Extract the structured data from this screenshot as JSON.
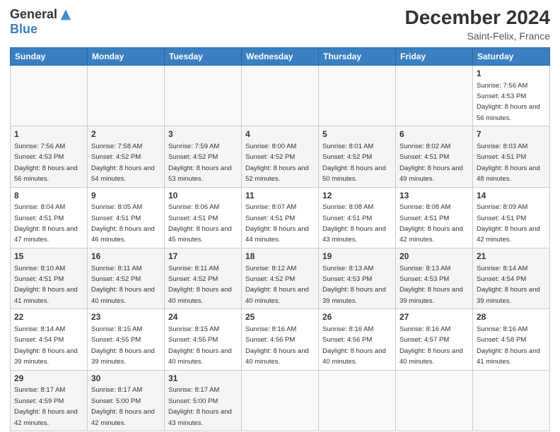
{
  "logo": {
    "general": "General",
    "blue": "Blue"
  },
  "header": {
    "title": "December 2024",
    "subtitle": "Saint-Felix, France"
  },
  "calendar": {
    "columns": [
      "Sunday",
      "Monday",
      "Tuesday",
      "Wednesday",
      "Thursday",
      "Friday",
      "Saturday"
    ],
    "weeks": [
      [
        null,
        null,
        null,
        null,
        null,
        null,
        {
          "day": "1",
          "sunrise": "Sunrise: 7:56 AM",
          "sunset": "Sunset: 4:53 PM",
          "daylight": "Daylight: 8 hours and 56 minutes."
        }
      ],
      [
        {
          "day": "1",
          "sunrise": "Sunrise: 7:56 AM",
          "sunset": "Sunset: 4:53 PM",
          "daylight": "Daylight: 8 hours and 56 minutes."
        },
        {
          "day": "2",
          "sunrise": "Sunrise: 7:58 AM",
          "sunset": "Sunset: 4:52 PM",
          "daylight": "Daylight: 8 hours and 54 minutes."
        },
        {
          "day": "3",
          "sunrise": "Sunrise: 7:59 AM",
          "sunset": "Sunset: 4:52 PM",
          "daylight": "Daylight: 8 hours and 53 minutes."
        },
        {
          "day": "4",
          "sunrise": "Sunrise: 8:00 AM",
          "sunset": "Sunset: 4:52 PM",
          "daylight": "Daylight: 8 hours and 52 minutes."
        },
        {
          "day": "5",
          "sunrise": "Sunrise: 8:01 AM",
          "sunset": "Sunset: 4:52 PM",
          "daylight": "Daylight: 8 hours and 50 minutes."
        },
        {
          "day": "6",
          "sunrise": "Sunrise: 8:02 AM",
          "sunset": "Sunset: 4:51 PM",
          "daylight": "Daylight: 8 hours and 49 minutes."
        },
        {
          "day": "7",
          "sunrise": "Sunrise: 8:03 AM",
          "sunset": "Sunset: 4:51 PM",
          "daylight": "Daylight: 8 hours and 48 minutes."
        }
      ],
      [
        {
          "day": "8",
          "sunrise": "Sunrise: 8:04 AM",
          "sunset": "Sunset: 4:51 PM",
          "daylight": "Daylight: 8 hours and 47 minutes."
        },
        {
          "day": "9",
          "sunrise": "Sunrise: 8:05 AM",
          "sunset": "Sunset: 4:51 PM",
          "daylight": "Daylight: 8 hours and 46 minutes."
        },
        {
          "day": "10",
          "sunrise": "Sunrise: 8:06 AM",
          "sunset": "Sunset: 4:51 PM",
          "daylight": "Daylight: 8 hours and 45 minutes."
        },
        {
          "day": "11",
          "sunrise": "Sunrise: 8:07 AM",
          "sunset": "Sunset: 4:51 PM",
          "daylight": "Daylight: 8 hours and 44 minutes."
        },
        {
          "day": "12",
          "sunrise": "Sunrise: 8:08 AM",
          "sunset": "Sunset: 4:51 PM",
          "daylight": "Daylight: 8 hours and 43 minutes."
        },
        {
          "day": "13",
          "sunrise": "Sunrise: 8:08 AM",
          "sunset": "Sunset: 4:51 PM",
          "daylight": "Daylight: 8 hours and 42 minutes."
        },
        {
          "day": "14",
          "sunrise": "Sunrise: 8:09 AM",
          "sunset": "Sunset: 4:51 PM",
          "daylight": "Daylight: 8 hours and 42 minutes."
        }
      ],
      [
        {
          "day": "15",
          "sunrise": "Sunrise: 8:10 AM",
          "sunset": "Sunset: 4:51 PM",
          "daylight": "Daylight: 8 hours and 41 minutes."
        },
        {
          "day": "16",
          "sunrise": "Sunrise: 8:11 AM",
          "sunset": "Sunset: 4:52 PM",
          "daylight": "Daylight: 8 hours and 40 minutes."
        },
        {
          "day": "17",
          "sunrise": "Sunrise: 8:11 AM",
          "sunset": "Sunset: 4:52 PM",
          "daylight": "Daylight: 8 hours and 40 minutes."
        },
        {
          "day": "18",
          "sunrise": "Sunrise: 8:12 AM",
          "sunset": "Sunset: 4:52 PM",
          "daylight": "Daylight: 8 hours and 40 minutes."
        },
        {
          "day": "19",
          "sunrise": "Sunrise: 8:13 AM",
          "sunset": "Sunset: 4:53 PM",
          "daylight": "Daylight: 8 hours and 39 minutes."
        },
        {
          "day": "20",
          "sunrise": "Sunrise: 8:13 AM",
          "sunset": "Sunset: 4:53 PM",
          "daylight": "Daylight: 8 hours and 39 minutes."
        },
        {
          "day": "21",
          "sunrise": "Sunrise: 8:14 AM",
          "sunset": "Sunset: 4:54 PM",
          "daylight": "Daylight: 8 hours and 39 minutes."
        }
      ],
      [
        {
          "day": "22",
          "sunrise": "Sunrise: 8:14 AM",
          "sunset": "Sunset: 4:54 PM",
          "daylight": "Daylight: 8 hours and 39 minutes."
        },
        {
          "day": "23",
          "sunrise": "Sunrise: 8:15 AM",
          "sunset": "Sunset: 4:55 PM",
          "daylight": "Daylight: 8 hours and 39 minutes."
        },
        {
          "day": "24",
          "sunrise": "Sunrise: 8:15 AM",
          "sunset": "Sunset: 4:55 PM",
          "daylight": "Daylight: 8 hours and 40 minutes."
        },
        {
          "day": "25",
          "sunrise": "Sunrise: 8:16 AM",
          "sunset": "Sunset: 4:56 PM",
          "daylight": "Daylight: 8 hours and 40 minutes."
        },
        {
          "day": "26",
          "sunrise": "Sunrise: 8:16 AM",
          "sunset": "Sunset: 4:56 PM",
          "daylight": "Daylight: 8 hours and 40 minutes."
        },
        {
          "day": "27",
          "sunrise": "Sunrise: 8:16 AM",
          "sunset": "Sunset: 4:57 PM",
          "daylight": "Daylight: 8 hours and 40 minutes."
        },
        {
          "day": "28",
          "sunrise": "Sunrise: 8:16 AM",
          "sunset": "Sunset: 4:58 PM",
          "daylight": "Daylight: 8 hours and 41 minutes."
        }
      ],
      [
        {
          "day": "29",
          "sunrise": "Sunrise: 8:17 AM",
          "sunset": "Sunset: 4:59 PM",
          "daylight": "Daylight: 8 hours and 42 minutes."
        },
        {
          "day": "30",
          "sunrise": "Sunrise: 8:17 AM",
          "sunset": "Sunset: 5:00 PM",
          "daylight": "Daylight: 8 hours and 42 minutes."
        },
        {
          "day": "31",
          "sunrise": "Sunrise: 8:17 AM",
          "sunset": "Sunset: 5:00 PM",
          "daylight": "Daylight: 8 hours and 43 minutes."
        },
        null,
        null,
        null,
        null
      ]
    ]
  }
}
